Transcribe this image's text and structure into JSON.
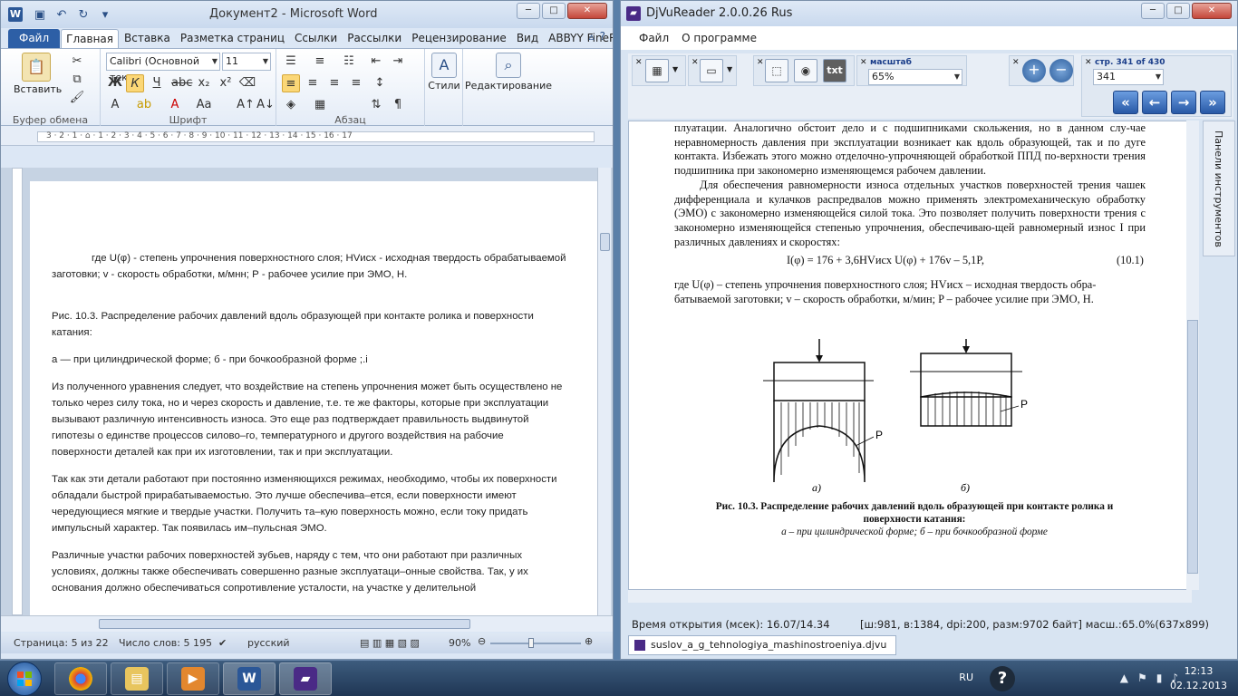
{
  "word": {
    "title": "Документ2 - Microsoft Word",
    "tabs": [
      "Файл",
      "Главная",
      "Вставка",
      "Разметка страниц",
      "Ссылки",
      "Рассылки",
      "Рецензирование",
      "Вид",
      "ABBYY FineReader"
    ],
    "active_tab": "Главная",
    "ribbon": {
      "paste_label": "Вставить",
      "font_name": "Calibri (Основной тек",
      "font_size": "11",
      "styles_label": "Стили",
      "edit_label": "Редактирование",
      "group_clipboard": "Буфер обмена",
      "group_font": "Шрифт",
      "group_paragraph": "Абзац"
    },
    "ruler_numbers": "3 · 2 · 1 · ⌂ · 1 · 2 · 3 · 4 · 5 · 6 · 7 · 8 · 9 · 10 · 11 · 12 · 13 · 14 · 15 · 16 · 17",
    "paragraphs": [
      "где U(φ) - степень упрочнения поверхностного слоя; HVисх - исходная твердость обрабатываемой заготовки; v - скорость обработки, м/мнн; Р - рабочее усилие при ЭМО, Н.",
      "Рис. 10.3. Распределение рабочих давлений вдоль образующей при контакте ролика и поверхности катания:",
      "а — при цилиндрической форме; б - при бочкообразной форме       ;.i",
      "Из полученного уравнения следует, что воздействие на степень упрочнения может быть осуществлено не только через силу тока, но и через скорость и давление, т.е. те же факторы, которые при эксплуатации вызывают различную интенсивность износа. Это еще раз подтверждает правильность выдвинутой гипотезы о единстве процессов силово–го, температурного и другого воздействия на рабочие поверхности деталей как при их изготовлении, так и при эксплуатации.",
      "Так как эти детали работают при постоянно изменяющихся режимах, необходимо, чтобы их поверхности обладали быстрой прирабатываемостью. Это лучше обеспечива–ется, если поверхности имеют чередующиеся мягкие и твердые участки. Получить та–кую поверхность можно, если току придать импульсный характер. Так появилась им–пульсная ЭМО.",
      "Различные участки рабочих поверхностей зубьев, наряду с тем, что они работают при различных условиях, должны также обеспечивать совершенно разные эксплуатаци–онные свойства. Так, у их основания должно обеспечиваться сопротивление усталости, на участке у делительной"
    ],
    "status": {
      "page": "Страница: 5 из 22",
      "words": "Число слов: 5 195",
      "lang": "русский",
      "zoom": "90%"
    }
  },
  "djvu": {
    "title": "DjVuReader 2.0.0.26 Rus",
    "menu": [
      "Файл",
      "О программе"
    ],
    "scale_label": "масштаб",
    "scale_value": "65%",
    "page_label": "стр. 341 of 430",
    "page_value": "341",
    "side_panel": "Панели инструментов",
    "scan_paragraph_1": "плуатации. Аналогично обстоит дело и с подшипниками скольжения, но в данном слу-чае неравномерность давления при эксплуатации возникает как вдоль образующей, так и по дуге контакта. Избежать этого можно отделочно-упрочняющей обработкой ППД по-верхности трения подшипника при закономерно изменяющемся рабочем давлении.",
    "scan_paragraph_2": "Для обеспечения равномерности износа отдельных участков поверхностей трения чашек дифференциала и кулачков распредвалов можно применять электромеханическую обработку (ЭМО) с закономерно изменяющейся силой тока. Это позволяет получить поверхности трения с закономерно изменяющейся степенью упрочнения, обеспечиваю-щей равномерный износ I при различных давлениях и скоростях:",
    "formula": "I(φ) = 176 + 3,6HVисх U(φ) + 176v – 5,1P,",
    "formula_number": "(10.1)",
    "scan_paragraph_3": "где U(φ) – степень упрочнения поверхностного слоя; HVисх – исходная твердость обра-батываемой заготовки; v – скорость обработки, м/мин; P – рабочее усилие при ЭМО, Н.",
    "fig_label_a": "а)",
    "fig_label_b": "б)",
    "fig_label_p1": "P",
    "fig_label_p2": "P",
    "caption_bold": "Рис. 10.3. Распределение рабочих давлений вдоль образующей при контакте ролика и поверхности катания:",
    "caption_text": "а – при цилиндрической форме; б – при бочкообразной форме",
    "status_time": "Время открытия (мсек): 16.07/14.34",
    "status_info": "[ш:981, в:1384, dpi:200, разм:9702 байт] масш.:65.0%(637x899)",
    "file_tab": "suslov_a_g_tehnologiya_mashinostroeniya.djvu"
  },
  "taskbar": {
    "lang": "RU",
    "time": "12:13",
    "date": "02.12.2013"
  }
}
